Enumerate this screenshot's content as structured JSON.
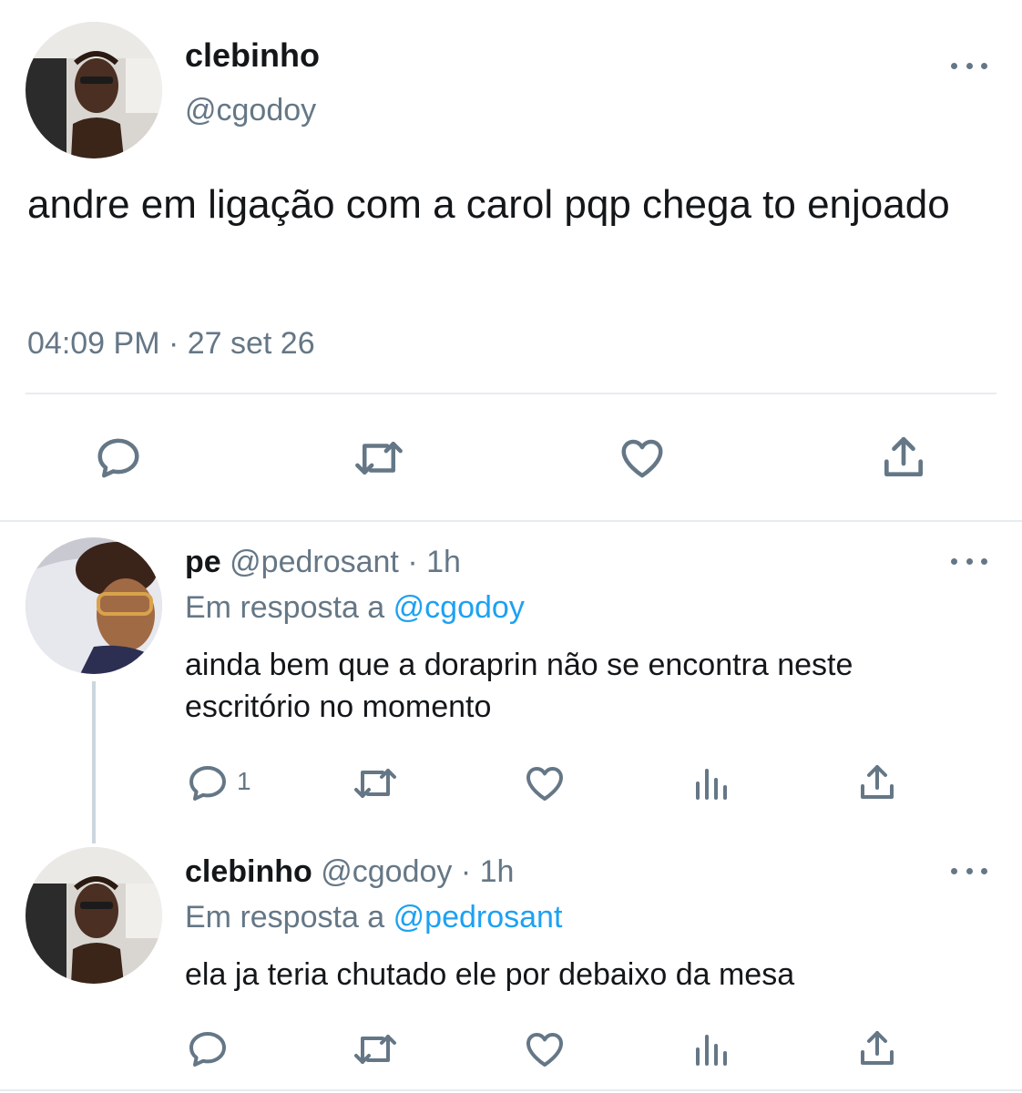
{
  "main_tweet": {
    "author_name": "clebinho",
    "author_handle": "@cgodoy",
    "text": "andre em ligação com a carol pqp chega to enjoado",
    "timestamp": "04:09 PM · 27 set 26",
    "actions": [
      "reply-icon",
      "retweet-icon",
      "like-icon",
      "share-icon"
    ]
  },
  "replies": [
    {
      "author_name": "pe",
      "author_handle": "@pedrosant",
      "separator": "·",
      "time": "1h",
      "reply_prefix": "Em resposta a",
      "reply_to": "@cgodoy",
      "text": "ainda bem que a doraprin não se encontra neste escritório no momento",
      "reply_count": "1",
      "actions": [
        "reply-icon",
        "retweet-icon",
        "like-icon",
        "analytics-icon",
        "share-icon"
      ]
    },
    {
      "author_name": "clebinho",
      "author_handle": "@cgodoy",
      "separator": "·",
      "time": "1h",
      "reply_prefix": "Em resposta a",
      "reply_to": "@pedrosant",
      "text": "ela ja teria chutado ele por debaixo da mesa",
      "reply_count": "",
      "actions": [
        "reply-icon",
        "retweet-icon",
        "like-icon",
        "analytics-icon",
        "share-icon"
      ]
    }
  ],
  "colors": {
    "text": "#14171a",
    "secondary": "#657786",
    "link": "#1da1f2",
    "divider": "#e6ecf0",
    "thread_line": "#ccd6dd"
  }
}
